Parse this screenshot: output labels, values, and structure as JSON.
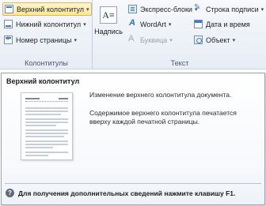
{
  "ribbon": {
    "header_footer_group": {
      "header_button": "Верхний колонтитул",
      "footer_button": "Нижний колонтитул",
      "page_number_button": "Номер страницы",
      "group_label": "Колонтитулы"
    },
    "text_group": {
      "textbox_button": "Надпись",
      "quick_parts_button": "Экспресс-блоки",
      "wordart_button": "WordArt",
      "dropcap_button": "Буквица",
      "signature_line_button": "Строка подписи",
      "date_time_button": "Дата и время",
      "object_button": "Объект",
      "group_label": "Текст"
    },
    "dropdown_caret": "▾"
  },
  "tooltip": {
    "title": "Верхний колонтитул",
    "description_1": "Изменение верхнего колонтитула документа.",
    "description_2": "Содержимое верхнего колонтитула печатается вверху каждой печатной страницы.",
    "help_text": "Для получения дополнительных сведений нажмите клавишу F1.",
    "help_icon": "?"
  },
  "colors": {
    "hover_highlight": "#ffe79a",
    "hover_border": "#e0b64f",
    "ribbon_bg": "#e7edf5",
    "icon_accent": "#3e79c7"
  },
  "icons": {
    "header": "header-icon",
    "footer": "footer-icon",
    "page_number": "page-number-icon",
    "textbox": "textbox-icon",
    "quick_parts": "quick-parts-icon",
    "wordart": "wordart-icon",
    "dropcap": "dropcap-icon",
    "signature": "signature-line-icon",
    "date_time": "calendar-icon",
    "object": "object-icon",
    "help": "help-icon"
  }
}
